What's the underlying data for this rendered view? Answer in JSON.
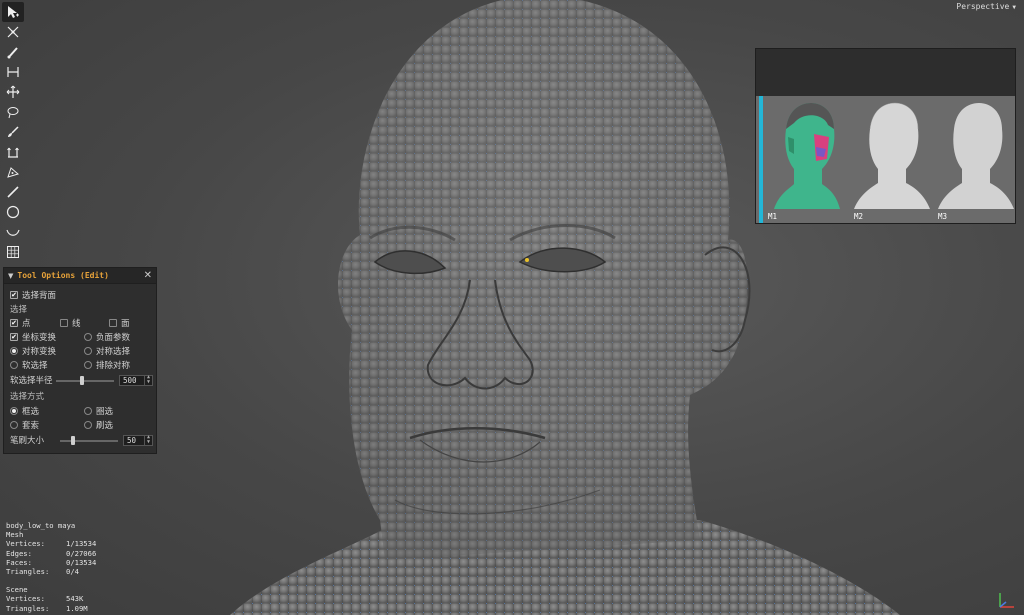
{
  "viewport": {
    "camera_label": "Perspective"
  },
  "toolbar": {
    "tools": [
      {
        "name": "select-tool-icon",
        "active": true
      },
      {
        "name": "transform-tool-icon"
      },
      {
        "name": "paint-tool-icon"
      },
      {
        "name": "measure-tool-icon"
      },
      {
        "name": "move-tool-icon"
      },
      {
        "name": "lasso-tool-icon"
      },
      {
        "name": "brush-tool-icon"
      },
      {
        "name": "extrude-tool-icon"
      },
      {
        "name": "pen-tool-icon"
      },
      {
        "name": "knife-tool-icon"
      },
      {
        "name": "circle-tool-icon"
      },
      {
        "name": "curve-tool-icon"
      },
      {
        "name": "grid-tool-icon"
      }
    ]
  },
  "tool_options": {
    "title": "Tool Options (Edit)",
    "select_backface": "选择背面",
    "selection_section": "选择",
    "point": "点",
    "edge": "线",
    "face": "面",
    "coord_transform": "坐标变换",
    "negative_param": "负面参数",
    "symmetric_transform": "对称变换",
    "symmetric_select": "对称选择",
    "soft_select": "软选择",
    "exclude_symmetry": "排除对称",
    "soft_radius_label": "软选择半径",
    "soft_radius_value": "500",
    "soft_radius_level": 0.45,
    "select_mode_section": "选择方式",
    "box_select": "框选",
    "circle_select": "圈选",
    "lasso": "套索",
    "brush_select": "刷选",
    "brush_size_label": "笔刷大小",
    "brush_size_value": "50",
    "brush_size_level": 0.2
  },
  "stats": {
    "object_name": "body_low_to maya",
    "mesh_label": "Mesh",
    "mesh": [
      {
        "k": "Vertices:",
        "v": "1/13534"
      },
      {
        "k": "Edges:",
        "v": "0/27066"
      },
      {
        "k": "Faces:",
        "v": "0/13534"
      },
      {
        "k": "Triangles:",
        "v": "0/4"
      }
    ],
    "scene_label": "Scene",
    "scene": [
      {
        "k": "Vertices:",
        "v": "543K"
      },
      {
        "k": "Triangles:",
        "v": "1.09M"
      }
    ]
  },
  "thumbnails": [
    {
      "label": "M1"
    },
    {
      "label": "M2"
    },
    {
      "label": "M3"
    }
  ],
  "colors": {
    "accent_title": "#e8a33a",
    "wire": "#5b8ed6",
    "thumb_bar": "#22b7d8"
  }
}
